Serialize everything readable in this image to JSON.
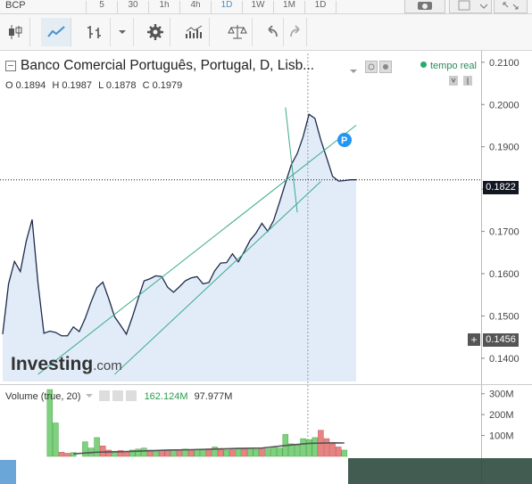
{
  "toolbar": {
    "symbol": "BCP",
    "timeframes": [
      "5",
      "30",
      "1h",
      "4h",
      "1D",
      "1W",
      "1M",
      "1D"
    ],
    "active_timeframe_index": 4,
    "icons": [
      "candles-icon",
      "line-chart-icon",
      "bars-icon",
      "chevron-down-icon",
      "gear-icon",
      "indicators-icon",
      "balance-icon",
      "undo-icon",
      "redo-icon",
      "camera-icon",
      "window-icon",
      "fullscreen-icon"
    ]
  },
  "header": {
    "title": "Banco Comercial Português, Portugal, D, Lisb...",
    "open_label": "O",
    "open": "0.1894",
    "high_label": "H",
    "high": "0.1987",
    "low_label": "L",
    "low": "0.1878",
    "close_label": "C",
    "close": "0.1979",
    "realtime": "tempo real"
  },
  "price_tags": {
    "last": "0.1822",
    "cursor": "0.1456"
  },
  "watermark": {
    "brand": "Investing",
    "suffix": ".com"
  },
  "volume": {
    "label": "Volume (true, 20)",
    "value1": "162.124M",
    "value2": "97.977M"
  },
  "colors": {
    "line": "#1d2b4a",
    "area": "#dce9f7",
    "trendline": "#3aaa8a",
    "vol_up": "#7fd07f",
    "vol_down": "#e68383",
    "vol_ma": "#555555"
  },
  "chart_data": [
    {
      "type": "area",
      "title": "Banco Comercial Português, Portugal, D, Lisb...",
      "ylim": [
        0.1345,
        0.2127
      ],
      "y_ticks": [
        "0.2100",
        "0.2000",
        "0.1900",
        "0.1800",
        "0.1700",
        "0.1600",
        "0.1500",
        "0.1400"
      ],
      "y_tick_values": [
        0.21,
        0.2,
        0.19,
        0.18,
        0.17,
        0.16,
        0.15,
        0.14
      ],
      "x": [
        0,
        1,
        2,
        3,
        4,
        5,
        6,
        7,
        8,
        9,
        10,
        11,
        12,
        13,
        14,
        15,
        16,
        17,
        18,
        19,
        20,
        21,
        22,
        23,
        24,
        25,
        26,
        27,
        28,
        29,
        30,
        31,
        32,
        33,
        34,
        35,
        36,
        37,
        38,
        39,
        40,
        41,
        42,
        43,
        44,
        45,
        46,
        47,
        48,
        49,
        50,
        51,
        52,
        53,
        54,
        55,
        56,
        57,
        58,
        59,
        60
      ],
      "values": [
        0.1457,
        0.1576,
        0.1629,
        0.1605,
        0.1677,
        0.1728,
        0.1577,
        0.1459,
        0.1464,
        0.1461,
        0.1453,
        0.1453,
        0.1474,
        0.1463,
        0.1494,
        0.1533,
        0.1567,
        0.158,
        0.1541,
        0.1498,
        0.1478,
        0.1457,
        0.1497,
        0.1541,
        0.1583,
        0.1588,
        0.1595,
        0.1593,
        0.1568,
        0.1556,
        0.1569,
        0.1583,
        0.159,
        0.1593,
        0.1576,
        0.1579,
        0.1607,
        0.1625,
        0.1626,
        0.1647,
        0.1628,
        0.1652,
        0.1679,
        0.1696,
        0.1719,
        0.17,
        0.1726,
        0.1769,
        0.1814,
        0.1858,
        0.1884,
        0.1924,
        0.1977,
        0.1967,
        0.1916,
        0.1874,
        0.183,
        0.1819,
        0.182,
        0.1822,
        0.1822
      ],
      "trendlines": [
        {
          "from": [
            6,
            0.1362
          ],
          "to": [
            60,
            0.1951
          ]
        },
        {
          "from": [
            19,
            0.1362
          ],
          "to": [
            54,
            0.1818
          ]
        },
        {
          "from": [
            48,
            0.1993
          ],
          "to": [
            50,
            0.1745
          ]
        }
      ]
    },
    {
      "type": "bar",
      "title": "Volume (true, 20)",
      "ylim": [
        0,
        350
      ],
      "y_ticks": [
        "300M",
        "200M",
        "100M"
      ],
      "y_tick_values": [
        300,
        200,
        100
      ],
      "bars": [
        {
          "i": 8,
          "v": 320,
          "up": true
        },
        {
          "i": 9,
          "v": 160,
          "up": true
        },
        {
          "i": 10,
          "v": 20,
          "up": false
        },
        {
          "i": 11,
          "v": 15,
          "up": false
        },
        {
          "i": 12,
          "v": 18,
          "up": true
        },
        {
          "i": 14,
          "v": 70,
          "up": true
        },
        {
          "i": 15,
          "v": 40,
          "up": true
        },
        {
          "i": 16,
          "v": 90,
          "up": true
        },
        {
          "i": 17,
          "v": 50,
          "up": false
        },
        {
          "i": 18,
          "v": 30,
          "up": false
        },
        {
          "i": 19,
          "v": 25,
          "up": true
        },
        {
          "i": 20,
          "v": 28,
          "up": false
        },
        {
          "i": 21,
          "v": 22,
          "up": false
        },
        {
          "i": 22,
          "v": 30,
          "up": true
        },
        {
          "i": 23,
          "v": 35,
          "up": true
        },
        {
          "i": 24,
          "v": 40,
          "up": true
        },
        {
          "i": 25,
          "v": 30,
          "up": false
        },
        {
          "i": 26,
          "v": 25,
          "up": true
        },
        {
          "i": 27,
          "v": 30,
          "up": false
        },
        {
          "i": 28,
          "v": 28,
          "up": false
        },
        {
          "i": 29,
          "v": 30,
          "up": true
        },
        {
          "i": 30,
          "v": 32,
          "up": false
        },
        {
          "i": 31,
          "v": 35,
          "up": true
        },
        {
          "i": 32,
          "v": 30,
          "up": false
        },
        {
          "i": 33,
          "v": 34,
          "up": true
        },
        {
          "i": 34,
          "v": 30,
          "up": true
        },
        {
          "i": 35,
          "v": 36,
          "up": false
        },
        {
          "i": 36,
          "v": 45,
          "up": true
        },
        {
          "i": 37,
          "v": 38,
          "up": false
        },
        {
          "i": 38,
          "v": 30,
          "up": true
        },
        {
          "i": 39,
          "v": 32,
          "up": false
        },
        {
          "i": 40,
          "v": 40,
          "up": true
        },
        {
          "i": 41,
          "v": 35,
          "up": false
        },
        {
          "i": 42,
          "v": 38,
          "up": true
        },
        {
          "i": 43,
          "v": 34,
          "up": true
        },
        {
          "i": 44,
          "v": 40,
          "up": false
        },
        {
          "i": 45,
          "v": 36,
          "up": true
        },
        {
          "i": 46,
          "v": 45,
          "up": true
        },
        {
          "i": 47,
          "v": 40,
          "up": true
        },
        {
          "i": 48,
          "v": 105,
          "up": true
        },
        {
          "i": 49,
          "v": 60,
          "up": true
        },
        {
          "i": 50,
          "v": 55,
          "up": true
        },
        {
          "i": 51,
          "v": 85,
          "up": true
        },
        {
          "i": 52,
          "v": 80,
          "up": true
        },
        {
          "i": 53,
          "v": 90,
          "up": true
        },
        {
          "i": 54,
          "v": 125,
          "up": false
        },
        {
          "i": 55,
          "v": 85,
          "up": false
        },
        {
          "i": 56,
          "v": 60,
          "up": false
        },
        {
          "i": 57,
          "v": 45,
          "up": false
        },
        {
          "i": 58,
          "v": 30,
          "up": true
        }
      ],
      "ma": [
        [
          12,
          12
        ],
        [
          16,
          20
        ],
        [
          20,
          22
        ],
        [
          24,
          26
        ],
        [
          28,
          30
        ],
        [
          32,
          32
        ],
        [
          36,
          35
        ],
        [
          40,
          38
        ],
        [
          44,
          40
        ],
        [
          48,
          52
        ],
        [
          52,
          62
        ],
        [
          56,
          65
        ],
        [
          58,
          64
        ]
      ]
    }
  ]
}
